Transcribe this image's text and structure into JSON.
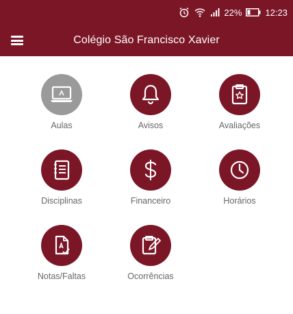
{
  "colors": {
    "brand": "#7b1627",
    "inactive": "#9a9a9a",
    "label": "#666666"
  },
  "status_bar": {
    "battery_percent": "22%",
    "time": "12:23",
    "icons": [
      "alarm-icon",
      "wifi-icon",
      "signal-icon",
      "battery-icon"
    ]
  },
  "app_bar": {
    "title": "Colégio São Francisco Xavier",
    "menu_icon": "hamburger-menu-icon"
  },
  "menu": [
    {
      "label": "Aulas",
      "icon": "laptop-icon",
      "active": false
    },
    {
      "label": "Avisos",
      "icon": "bell-icon",
      "active": true
    },
    {
      "label": "Avaliações",
      "icon": "clipboard-star-icon",
      "active": true
    },
    {
      "label": "Disciplinas",
      "icon": "notebook-icon",
      "active": true
    },
    {
      "label": "Financeiro",
      "icon": "dollar-icon",
      "active": true
    },
    {
      "label": "Horários",
      "icon": "clock-icon",
      "active": true
    },
    {
      "label": "Notas/Faltas",
      "icon": "grade-document-icon",
      "active": true
    },
    {
      "label": "Ocorrências",
      "icon": "clipboard-pencil-icon",
      "active": true
    }
  ]
}
